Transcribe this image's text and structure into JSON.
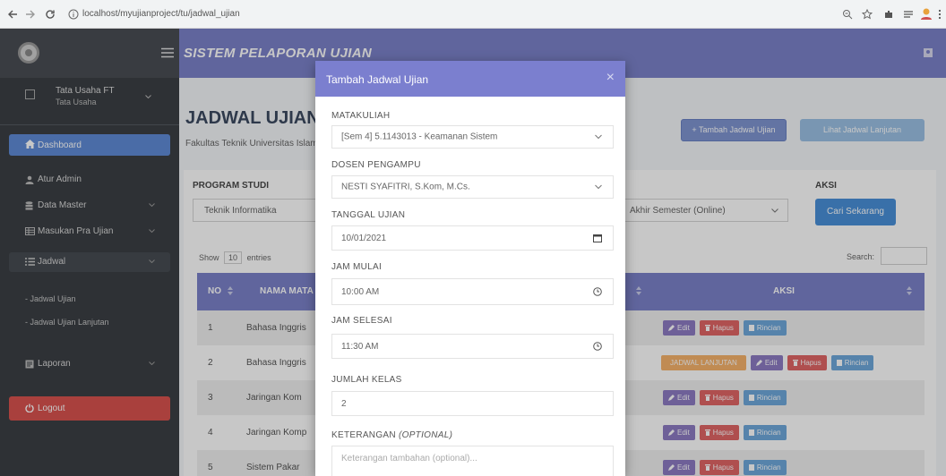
{
  "browser": {
    "url": "localhost/myujianproject/tu/jadwal_ujian",
    "icons": [
      "back-icon",
      "forward-icon",
      "reload-icon",
      "info-icon",
      "zoom-icon",
      "star-icon",
      "extension-icon",
      "reading-list-icon",
      "profile-avatar-icon",
      "more-icon"
    ]
  },
  "app": {
    "title": "SISTEM PELAPORAN UJIAN"
  },
  "sidebar": {
    "user_name": "Tata Usaha FT",
    "user_role": "Tata Usaha",
    "items": [
      {
        "label": "Dashboard",
        "icon": "home-icon"
      },
      {
        "label": "Atur Admin",
        "icon": "user-icon"
      },
      {
        "label": "Data Master",
        "icon": "database-icon"
      },
      {
        "label": "Masukan Pra Ujian",
        "icon": "table-icon"
      },
      {
        "label": "Jadwal",
        "icon": "list-icon"
      },
      {
        "label": "Laporan",
        "icon": "report-icon"
      }
    ],
    "subitems": [
      "- Jadwal Ujian",
      "- Jadwal Ujian Lanjutan"
    ],
    "logout": "Logout"
  },
  "page": {
    "title": "JADWAL UJIAN",
    "subtitle": "Fakultas Teknik Universitas Islam",
    "add_button": "+ Tambah Jadwal Ujian",
    "view_button": "Lihat Jadwal Lanjutan"
  },
  "filter": {
    "prodi_label": "PROGRAM STUDI",
    "prodi_value": "Teknik Informatika",
    "jenis_value": "Akhir Semester (Online)",
    "aksi_label": "AKSI",
    "search_button": "Cari Sekarang"
  },
  "table": {
    "show": "Show",
    "entries_count": "10",
    "entries": "entries",
    "search_label": "Search:",
    "headers": [
      "NO",
      "NAMA MATA",
      "AKSI"
    ],
    "edit_label": "Edit",
    "hapus_label": "Hapus",
    "rincian_label": "Rincian",
    "lanjutan_label": "JADWAL LANJUTAN",
    "rows": [
      {
        "no": "1",
        "name": "Bahasa Inggris"
      },
      {
        "no": "2",
        "name": "Bahasa Inggris"
      },
      {
        "no": "3",
        "name": "Jaringan Kom"
      },
      {
        "no": "4",
        "name": "Jaringan Komp"
      },
      {
        "no": "5",
        "name": "Sistem Pakar"
      }
    ]
  },
  "modal": {
    "title": "Tambah Jadwal Ujian",
    "close": "×",
    "fields": [
      {
        "label": "MATAKULIAH",
        "value": "[Sem 4] 5.1143013 - Keamanan Sistem"
      },
      {
        "label": "DOSEN PENGAMPU",
        "value": "NESTI SYAFITRI, S.Kom, M.Cs."
      },
      {
        "label": "TANGGAL UJIAN",
        "value": "10/01/2021"
      },
      {
        "label": "JAM MULAI",
        "value": "10:00 AM"
      },
      {
        "label": "JAM SELESAI",
        "value": "11:30 AM"
      },
      {
        "label": "JUMLAH KELAS",
        "value": "2"
      },
      {
        "label": "KETERANGAN ",
        "label_suffix": "(OPTIONAL)",
        "placeholder": "Keterangan tambahan (optional)..."
      }
    ]
  },
  "colors": {
    "header": "#7c82c9",
    "modal_header": "#7b7fcf",
    "sidebar": "#3b3f44",
    "active_item": "#5f8bd6",
    "logout": "#d9534f",
    "edit": "#8e7cc3",
    "hapus": "#e06666",
    "rincian": "#6fa8dc",
    "lanjutan": "#f6b26b"
  }
}
